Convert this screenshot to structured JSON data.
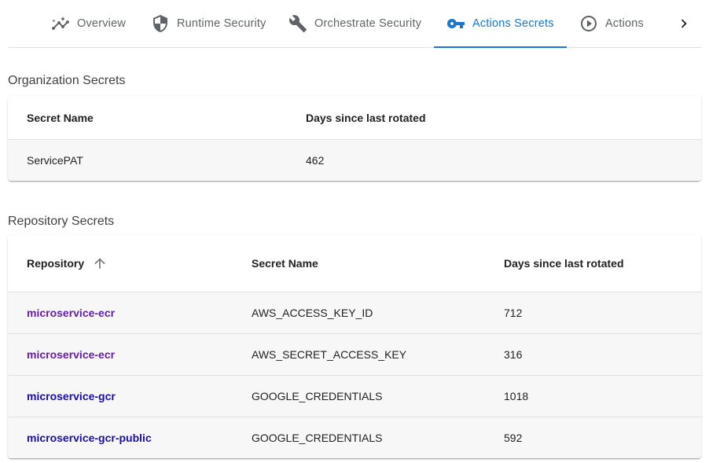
{
  "tabs": [
    {
      "label": "Overview",
      "icon": "analytics-icon"
    },
    {
      "label": "Runtime Security",
      "icon": "shield-icon"
    },
    {
      "label": "Orchestrate Security",
      "icon": "wrench-icon"
    },
    {
      "label": "Actions Secrets",
      "icon": "key-icon",
      "active": true
    },
    {
      "label": "Actions",
      "icon": "play-circle-icon"
    }
  ],
  "colors": {
    "accent": "#1976d2",
    "visited_link": "#681da8",
    "link": "#1a0dab"
  },
  "org_secrets": {
    "title": "Organization Secrets",
    "headers": {
      "secret_name": "Secret Name",
      "days": "Days since last rotated"
    },
    "rows": [
      {
        "secret_name": "ServicePAT",
        "days": "462"
      }
    ]
  },
  "repo_secrets": {
    "title": "Repository Secrets",
    "headers": {
      "repository": "Repository",
      "secret_name": "Secret Name",
      "days": "Days since last rotated"
    },
    "rows": [
      {
        "repository": "microservice-ecr",
        "secret_name": "AWS_ACCESS_KEY_ID",
        "days": "712",
        "visited": true
      },
      {
        "repository": "microservice-ecr",
        "secret_name": "AWS_SECRET_ACCESS_KEY",
        "days": "316",
        "visited": true
      },
      {
        "repository": "microservice-gcr",
        "secret_name": "GOOGLE_CREDENTIALS",
        "days": "1018",
        "visited": false
      },
      {
        "repository": "microservice-gcr-public",
        "secret_name": "GOOGLE_CREDENTIALS",
        "days": "592",
        "visited": false
      }
    ]
  }
}
